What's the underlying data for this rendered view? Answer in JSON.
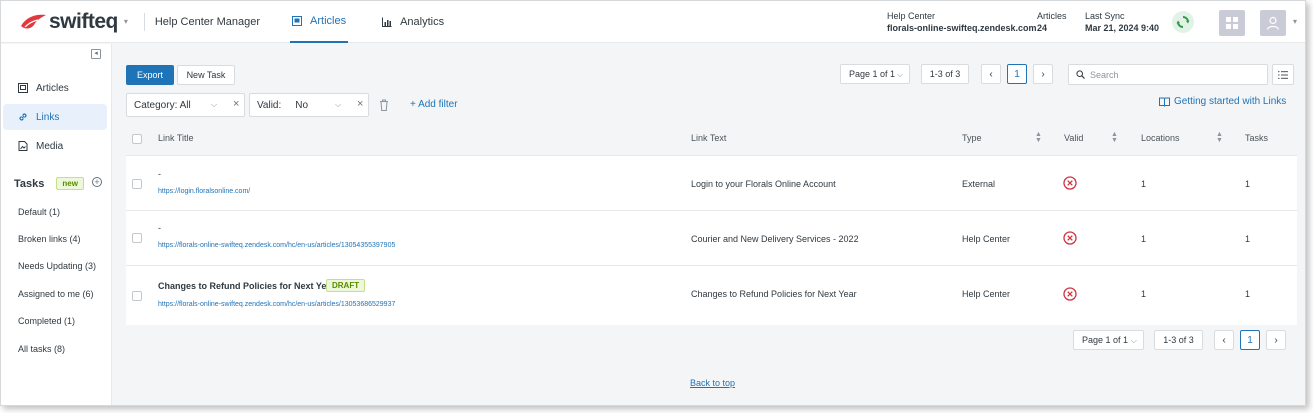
{
  "header": {
    "brand": "swifteq",
    "app_title": "Help Center Manager",
    "tabs": [
      {
        "label": "Articles",
        "icon": "article-icon",
        "active": true
      },
      {
        "label": "Analytics",
        "icon": "chart-icon",
        "active": false
      }
    ],
    "help_center_label": "Help Center",
    "help_center_value": "florals-online-swifteq.zendesk.com",
    "articles_label": "Articles",
    "articles_value": "24",
    "last_sync_label": "Last Sync",
    "last_sync_value": "Mar 21, 2024 9:40"
  },
  "sidebar": {
    "items": [
      {
        "label": "Articles",
        "icon": "article-icon"
      },
      {
        "label": "Links",
        "icon": "link-icon",
        "active": true
      },
      {
        "label": "Media",
        "icon": "media-icon"
      }
    ],
    "tasks_label": "Tasks",
    "tasks_badge": "new",
    "task_items": [
      "Default (1)",
      "Broken links (4)",
      "Needs Updating (3)",
      "Assigned to me (6)",
      "Completed (1)",
      "All tasks (8)"
    ]
  },
  "toolbar": {
    "export_label": "Export",
    "new_task_label": "New Task",
    "page_select": "Page 1 of 1",
    "range": "1-3 of 3",
    "current_page": "1",
    "search_placeholder": "Search"
  },
  "filters": {
    "category_label": "Category: All",
    "valid_label": "Valid:",
    "valid_value": "No",
    "add_filter": "+ Add filter",
    "getting_started": "Getting started with Links"
  },
  "table": {
    "columns": [
      "Link Title",
      "Link Text",
      "Type",
      "Valid",
      "Locations",
      "Tasks"
    ],
    "rows": [
      {
        "title": "-",
        "url": "https://login.floralsonline.com/",
        "link_text": "Login to your Florals Online Account",
        "type": "External",
        "valid": false,
        "locations": "1",
        "tasks": "1"
      },
      {
        "title": "-",
        "url": "https://florals-online-swifteq.zendesk.com/hc/en-us/articles/13054355397905",
        "link_text": "Courier and New Delivery Services - 2022",
        "type": "Help Center",
        "valid": false,
        "locations": "1",
        "tasks": "1"
      },
      {
        "title": "Changes to Refund Policies for Next Year",
        "badge": "DRAFT",
        "url": "https://florals-online-swifteq.zendesk.com/hc/en-us/articles/13053686529937",
        "link_text": "Changes to Refund Policies for Next Year",
        "type": "Help Center",
        "valid": false,
        "locations": "1",
        "tasks": "1"
      }
    ]
  },
  "footer": {
    "page_select": "Page 1 of 1",
    "range": "1-3 of 3",
    "current_page": "1",
    "back_to_top": "Back to top"
  },
  "colors": {
    "accent": "#1f73b7",
    "brand_red": "#e03a3e",
    "invalid_red": "#cc3340",
    "sync_green": "#2e9e48",
    "draft_green": "#5a8a00"
  }
}
